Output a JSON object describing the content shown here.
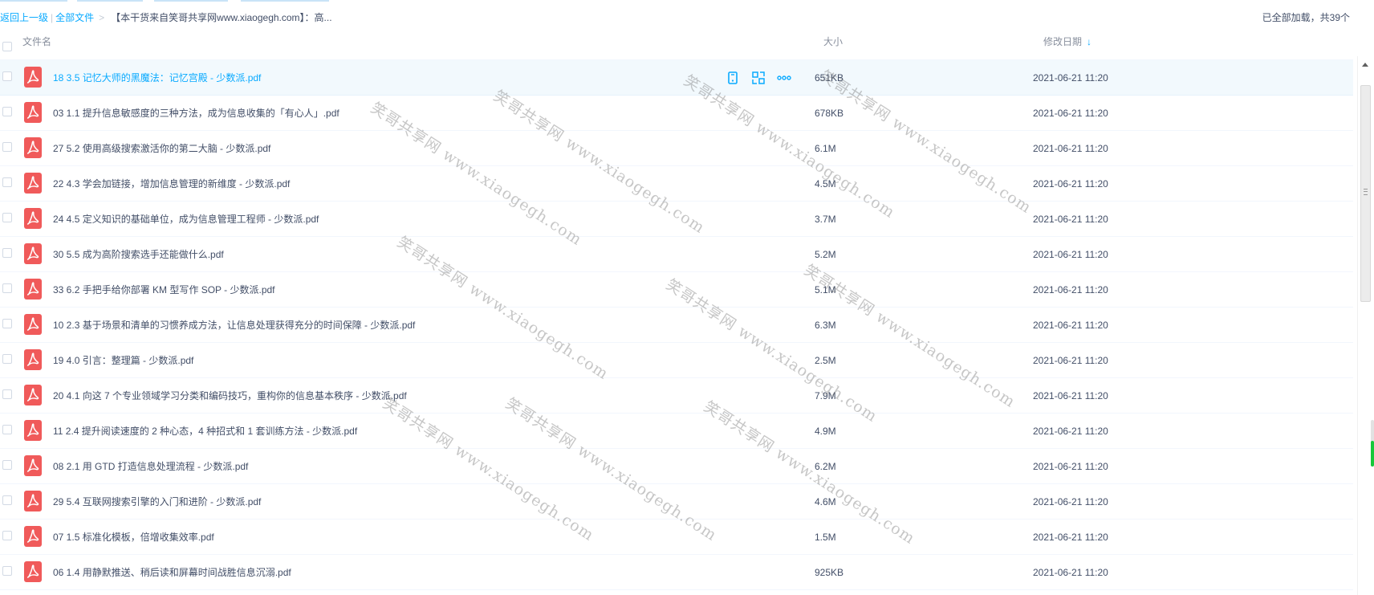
{
  "breadcrumb": {
    "back_label": "返回上一级",
    "separator": "|",
    "all_files_label": "全部文件",
    "gt": ">",
    "current_folder": "【本干货来自笑哥共享网www.xiaogegh.com】：高...",
    "load_status": "已全部加载，共39个"
  },
  "header": {
    "name_label": "文件名",
    "size_label": "大小",
    "date_label": "修改日期",
    "sort_arrow": "↓"
  },
  "colors": {
    "accent": "#09aaff",
    "pdf_icon": "#f05a5a",
    "hover_row": "#f2f9fd"
  },
  "files": [
    {
      "name": "18 3.5 记忆大师的黑魔法：记忆宫殿 - 少数派.pdf",
      "size": "651KB",
      "date": "2021-06-21 11:20",
      "hovered": true
    },
    {
      "name": "03 1.1 提升信息敏感度的三种方法，成为信息收集的「有心人」.pdf",
      "size": "678KB",
      "date": "2021-06-21 11:20"
    },
    {
      "name": "27 5.2 使用高级搜索激活你的第二大脑 - 少数派.pdf",
      "size": "6.1M",
      "date": "2021-06-21 11:20"
    },
    {
      "name": "22 4.3 学会加链接，增加信息管理的新维度 - 少数派.pdf",
      "size": "4.5M",
      "date": "2021-06-21 11:20"
    },
    {
      "name": "24 4.5 定义知识的基础单位，成为信息管理工程师 - 少数派.pdf",
      "size": "3.7M",
      "date": "2021-06-21 11:20"
    },
    {
      "name": "30 5.5 成为高阶搜索选手还能做什么.pdf",
      "size": "5.2M",
      "date": "2021-06-21 11:20"
    },
    {
      "name": "33 6.2 手把手给你部署 KM 型写作 SOP - 少数派.pdf",
      "size": "5.1M",
      "date": "2021-06-21 11:20"
    },
    {
      "name": "10 2.3 基于场景和清单的习惯养成方法，让信息处理获得充分的时间保障 - 少数派.pdf",
      "size": "6.3M",
      "date": "2021-06-21 11:20"
    },
    {
      "name": "19 4.0 引言：整理篇 - 少数派.pdf",
      "size": "2.5M",
      "date": "2021-06-21 11:20"
    },
    {
      "name": "20 4.1 向这 7 个专业领域学习分类和编码技巧，重构你的信息基本秩序 - 少数派.pdf",
      "size": "7.9M",
      "date": "2021-06-21 11:20"
    },
    {
      "name": "11 2.4 提升阅读速度的 2 种心态，4 种招式和 1 套训练方法 - 少数派.pdf",
      "size": "4.9M",
      "date": "2021-06-21 11:20"
    },
    {
      "name": "08 2.1 用 GTD 打造信息处理流程 - 少数派.pdf",
      "size": "6.2M",
      "date": "2021-06-21 11:20"
    },
    {
      "name": "29 5.4 互联网搜索引擎的入门和进阶 - 少数派.pdf",
      "size": "4.6M",
      "date": "2021-06-21 11:20"
    },
    {
      "name": "07 1.5 标准化模板，倍增收集效率.pdf",
      "size": "1.5M",
      "date": "2021-06-21 11:20"
    },
    {
      "name": "06 1.4 用静默推送、稍后读和屏幕时间战胜信息沉溺.pdf",
      "size": "925KB",
      "date": "2021-06-21 11:20"
    }
  ],
  "row_actions": {
    "icons": [
      "phone-icon",
      "share-icon",
      "more-icon"
    ]
  },
  "watermark": {
    "text": "笑哥共享网 www.xiaogegh.com"
  },
  "scroll_indicator_level": 0.55
}
